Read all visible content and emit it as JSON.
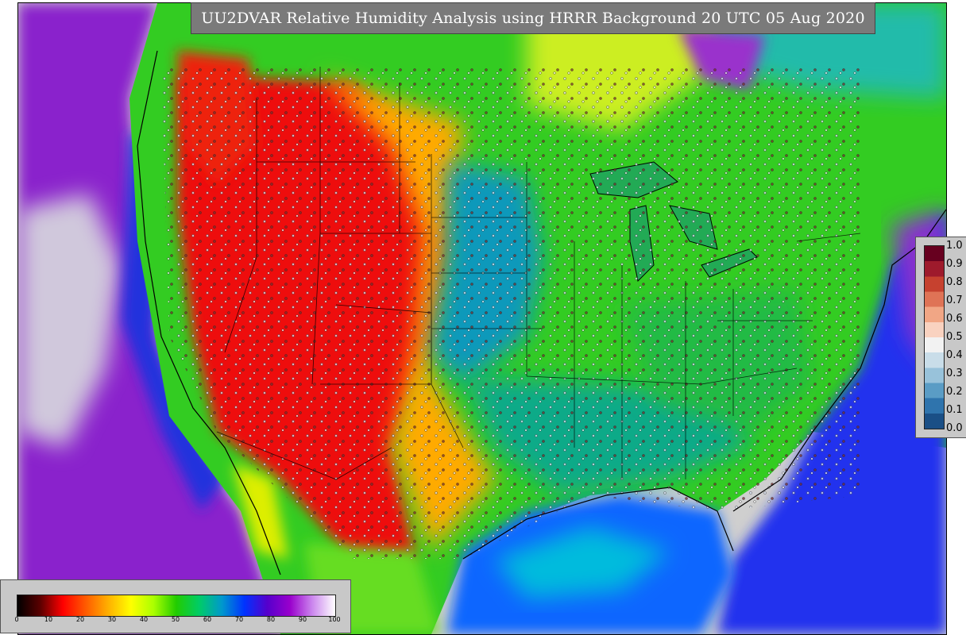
{
  "title": "UU2DVAR Relative Humidity Analysis using HRRR Background 20 UTC 05 Aug 2020",
  "obs_colorbar": {
    "ticks": [
      "1.0",
      "0.9",
      "0.8",
      "0.7",
      "0.6",
      "0.5",
      "0.4",
      "0.3",
      "0.2",
      "0.1",
      "0.0"
    ],
    "colors": [
      "#67001f",
      "#9e1a2c",
      "#c6412f",
      "#df7356",
      "#f1a685",
      "#f9d2c0",
      "#f2f2f2",
      "#c9dde9",
      "#98c2da",
      "#5a9cc5",
      "#2f74ad",
      "#1a4f86"
    ]
  },
  "rh_colorbar": {
    "ticks": [
      "0",
      "10",
      "20",
      "30",
      "40",
      "50",
      "60",
      "70",
      "80",
      "90",
      "100"
    ],
    "stops": [
      "#000000",
      "#5a0000",
      "#ff0000",
      "#ff5a00",
      "#ffb000",
      "#ffff00",
      "#aaff00",
      "#22cc00",
      "#00cc66",
      "#0099cc",
      "#0033ff",
      "#5500cc",
      "#9900cc",
      "#cc88ee",
      "#ffffff"
    ]
  },
  "map_regions": {
    "background_land": "#44cc22",
    "dry_west": "#ee1111",
    "moderate_plains": "#ffbb00",
    "humid_midwest": "#11aa66",
    "ocean": "#2233ee",
    "offshore_purple": "#8a22cc",
    "no_data": "#cfcfcf"
  }
}
